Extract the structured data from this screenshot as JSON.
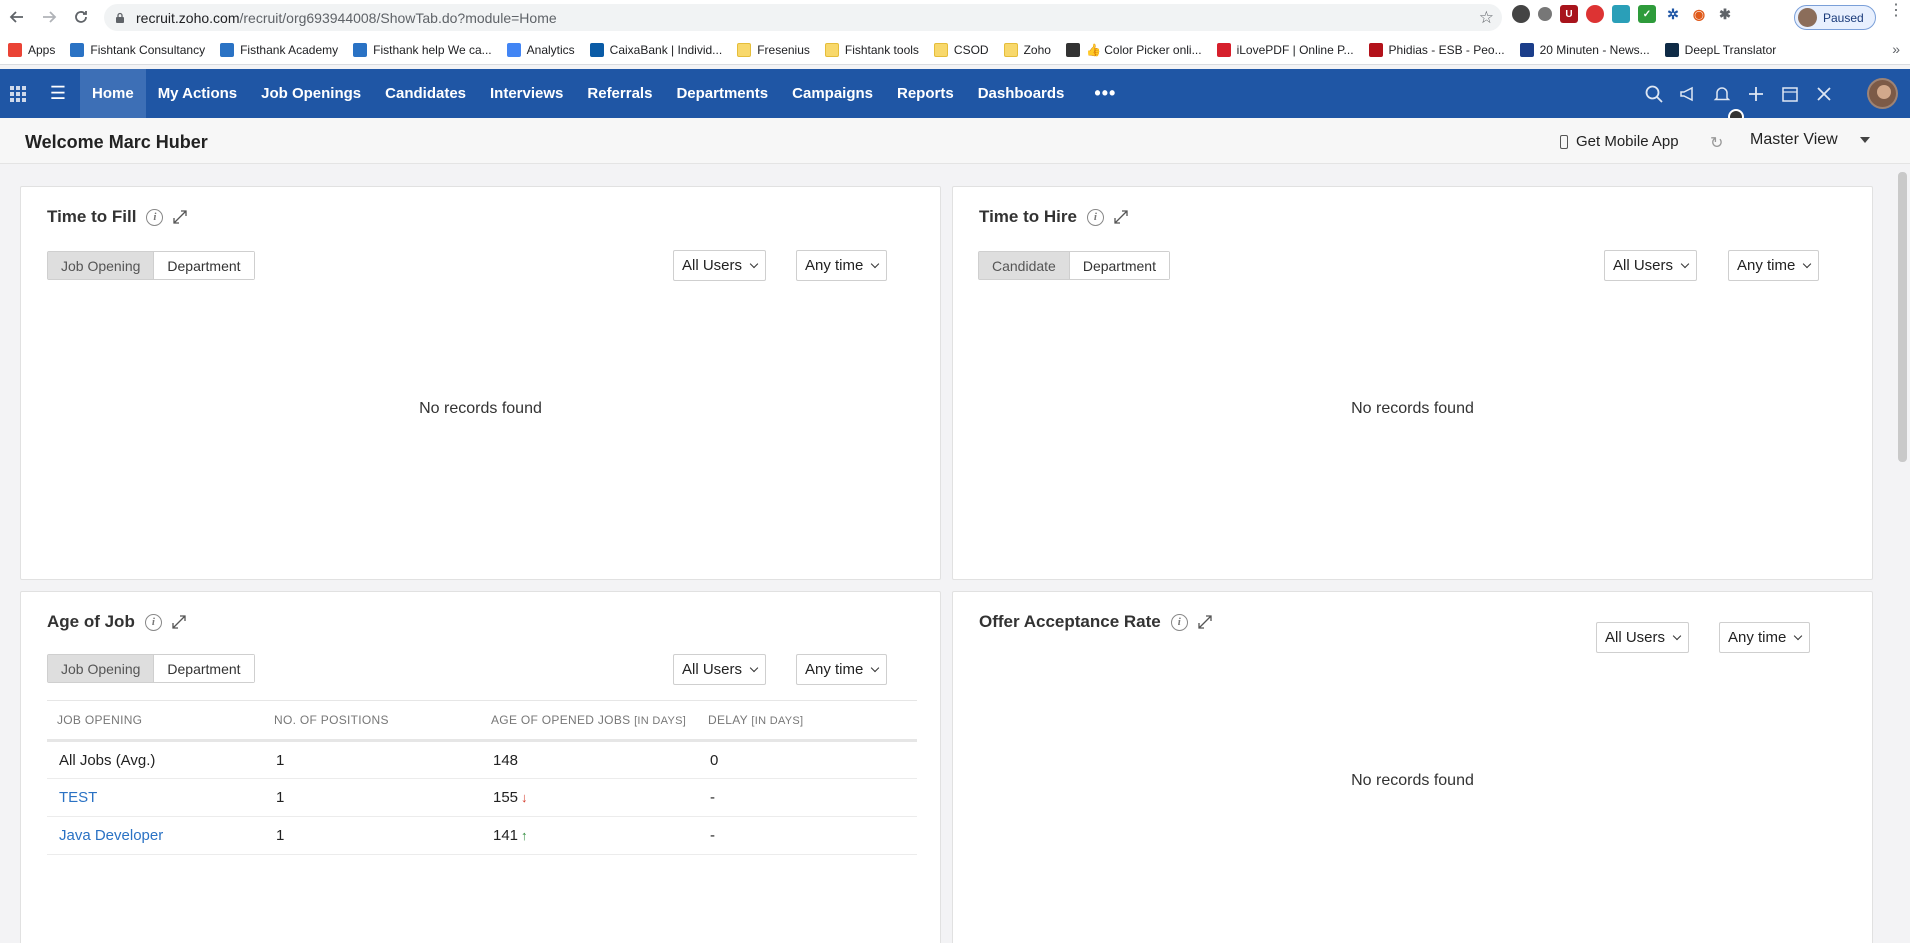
{
  "browser": {
    "url_host": "recruit.zoho.com",
    "url_path": "/recruit/org693944008/ShowTab.do?module=Home",
    "profile_label": "Paused",
    "bookmarks": [
      {
        "label": "Apps",
        "icon": "apps-grid-icon"
      },
      {
        "label": "Fishtank Consultancy",
        "icon": "fishtank-icon"
      },
      {
        "label": "Fisthank Academy",
        "icon": "fishtank-icon"
      },
      {
        "label": "Fisthank help We ca...",
        "icon": "fishtank-help-icon"
      },
      {
        "label": "Analytics",
        "icon": "google-icon"
      },
      {
        "label": "CaixaBank | Individ...",
        "icon": "caixabank-icon"
      },
      {
        "label": "Fresenius",
        "icon": "folder-icon"
      },
      {
        "label": "Fishtank tools",
        "icon": "folder-icon"
      },
      {
        "label": "CSOD",
        "icon": "folder-icon"
      },
      {
        "label": "Zoho",
        "icon": "folder-icon"
      },
      {
        "label": "👍 Color Picker onli...",
        "icon": "color-picker-icon"
      },
      {
        "label": "iLovePDF | Online P...",
        "icon": "ilovepdf-icon"
      },
      {
        "label": "Phidias - ESB - Peo...",
        "icon": "phidias-icon"
      },
      {
        "label": "20 Minuten - News...",
        "icon": "20min-icon"
      },
      {
        "label": "DeepL Translator",
        "icon": "deepl-icon"
      }
    ]
  },
  "nav": {
    "tabs": [
      "Home",
      "My Actions",
      "Job Openings",
      "Candidates",
      "Interviews",
      "Referrals",
      "Departments",
      "Campaigns",
      "Reports",
      "Dashboards"
    ],
    "more": "•••"
  },
  "welcome": {
    "title": "Welcome Marc Huber",
    "mobile_app": "Get Mobile App",
    "view": "Master View"
  },
  "cards": {
    "time_to_fill": {
      "title": "Time to Fill",
      "toggle": [
        "Job Opening",
        "Department"
      ],
      "users": "All Users",
      "time": "Any time",
      "empty": "No records found"
    },
    "time_to_hire": {
      "title": "Time to Hire",
      "toggle": [
        "Candidate",
        "Department"
      ],
      "users": "All Users",
      "time": "Any time",
      "empty": "No records found"
    },
    "age_of_job": {
      "title": "Age of Job",
      "toggle": [
        "Job Opening",
        "Department"
      ],
      "users": "All Users",
      "time": "Any time",
      "columns": [
        "JOB OPENING",
        "NO. OF POSITIONS",
        "AGE OF OPENED JOBS",
        "[IN DAYS]",
        "DELAY",
        "[IN DAYS]"
      ],
      "rows": [
        {
          "job": "All Jobs (Avg.)",
          "positions": "1",
          "age": "148",
          "trend": "",
          "delay": "0"
        },
        {
          "job": "TEST",
          "positions": "1",
          "age": "155",
          "trend": "down",
          "delay": "-"
        },
        {
          "job": "Java Developer",
          "positions": "1",
          "age": "141",
          "trend": "up",
          "delay": "-"
        }
      ]
    },
    "offer_acceptance": {
      "title": "Offer Acceptance Rate",
      "users": "All Users",
      "time": "Any time",
      "empty": "No records found"
    }
  },
  "colors": {
    "nav_bg": "#1f56a5",
    "nav_active": "#3d6fb6",
    "link": "#2a72c4",
    "trend_down": "#d43a2a",
    "trend_up": "#2e8b3b"
  }
}
